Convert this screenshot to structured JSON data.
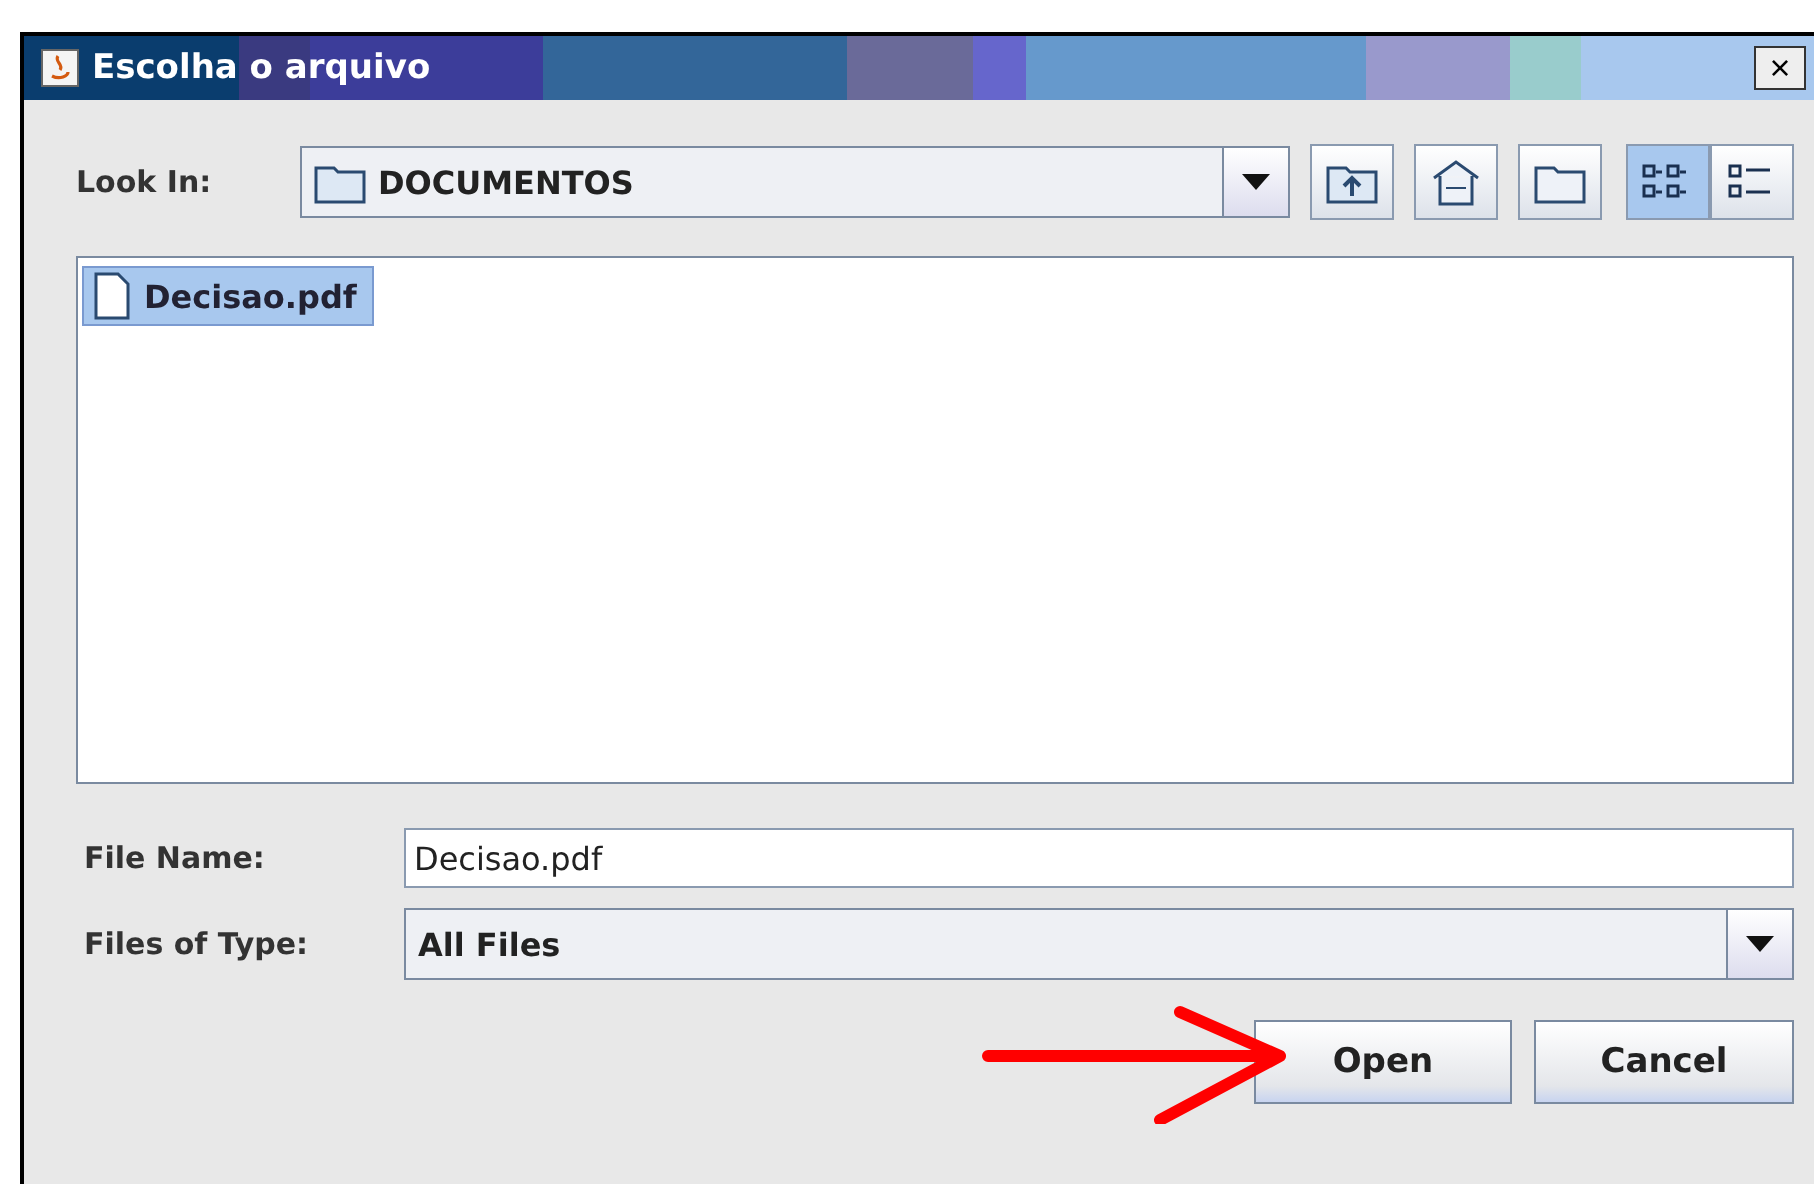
{
  "window": {
    "title": "Escolha o arquivo",
    "close": "×"
  },
  "look_in": {
    "label": "Look In:",
    "value": "DOCUMENTOS"
  },
  "toolbar": [
    {
      "kind": "up"
    },
    {
      "kind": "home"
    },
    {
      "kind": "new-folder"
    }
  ],
  "views": [
    {
      "kind": "list",
      "selected": true
    },
    {
      "kind": "details",
      "selected": false
    }
  ],
  "files": [
    {
      "name": "Decisao.pdf",
      "selected": true
    }
  ],
  "file_name": {
    "label": "File Name:",
    "value": "Decisao.pdf"
  },
  "file_type": {
    "label": "Files of Type:",
    "value": "All Files"
  },
  "buttons": [
    {
      "label": "Open",
      "kind": "primary"
    },
    {
      "label": "Cancel",
      "kind": "secondary"
    }
  ]
}
